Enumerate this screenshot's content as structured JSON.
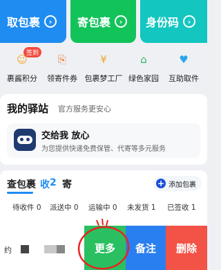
{
  "top_cards": [
    {
      "label": "取包裹",
      "arrow": "›"
    },
    {
      "label": "寄包裹",
      "arrow": "›"
    },
    {
      "label": "身份码",
      "arrow": "›"
    }
  ],
  "quick": [
    {
      "label": "裹酱积分",
      "icon": "smile-icon",
      "badge": "签到",
      "glyph": "☺",
      "color": "#f4a623"
    },
    {
      "label": "领寄件券",
      "icon": "coupon-icon",
      "glyph": "⎘",
      "color": "#f07a2a"
    },
    {
      "label": "包裹梦工厂",
      "icon": "coin-icon",
      "glyph": "¥",
      "color": "#f0a52a"
    },
    {
      "label": "绿色家园",
      "icon": "home-icon",
      "glyph": "⌂",
      "color": "#31b45a"
    },
    {
      "label": "互助取件",
      "icon": "heart-icon",
      "glyph": "♥",
      "color": "#2aa6e8"
    }
  ],
  "station": {
    "title": "我的驿站",
    "subtitle": "官方服务更安心",
    "card_title": "交给我 放心",
    "card_desc": "为您提供快递免费保管、代寄等多元服务"
  },
  "packages": {
    "tabs": [
      "查包裹",
      "收",
      "2",
      "寄"
    ],
    "add_label": "添加包裹",
    "stats": [
      {
        "label": "待收件",
        "count": "0"
      },
      {
        "label": "派送中",
        "count": "0"
      },
      {
        "label": "运输中",
        "count": "0"
      },
      {
        "label": "未发货",
        "count": "1"
      },
      {
        "label": "已签收",
        "count": "1"
      }
    ]
  },
  "row": {
    "text": "约",
    "actions": [
      "更多",
      "备注",
      "删除"
    ]
  },
  "colors": {
    "blue": "#1e8cf0",
    "green": "#12c35a",
    "teal": "#13c6c0",
    "red": "#f35246"
  }
}
